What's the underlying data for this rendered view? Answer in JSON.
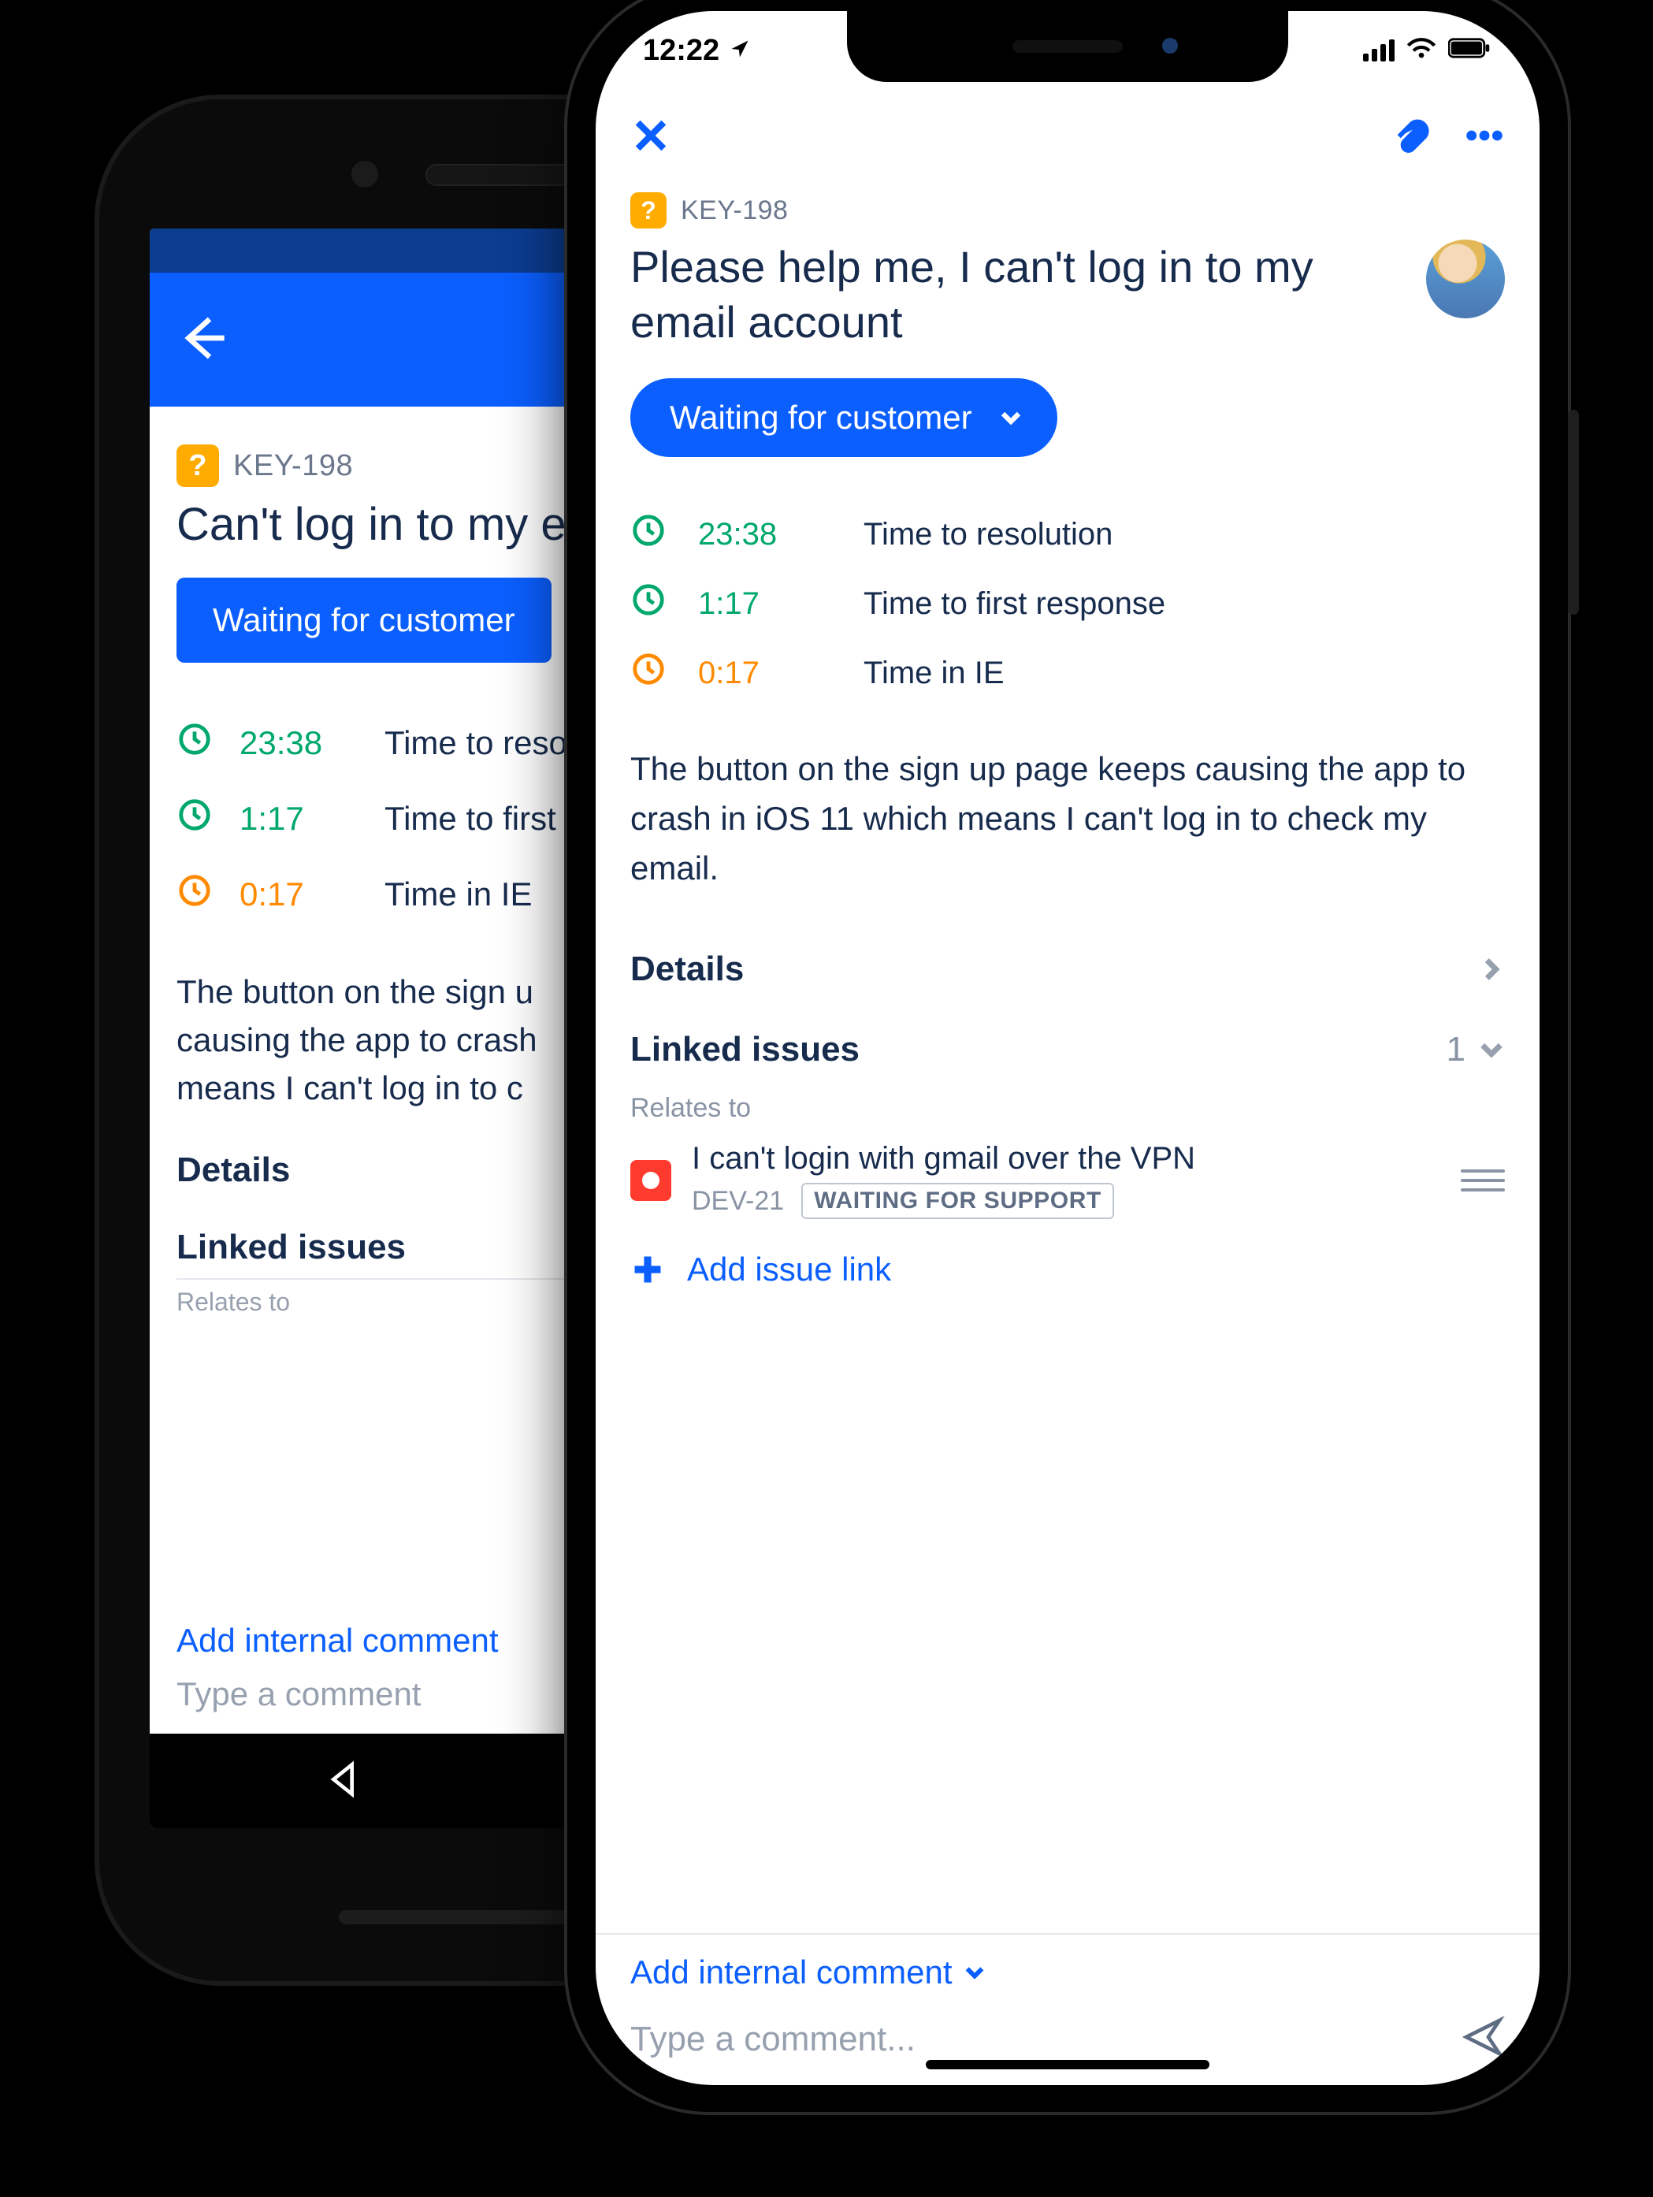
{
  "colors": {
    "accent": "#0b5fff",
    "green": "#00a86b",
    "orange": "#ff8a00",
    "text": "#172b4d",
    "muted": "#8993a4"
  },
  "android": {
    "issue_key": "KEY-198",
    "title": "Can't log in to my em",
    "status_label": "Waiting for customer",
    "sla": [
      {
        "time": "23:38",
        "label": "Time to resolu",
        "tone": "green"
      },
      {
        "time": "1:17",
        "label": "Time to first re",
        "tone": "green"
      },
      {
        "time": "0:17",
        "label": "Time in IE",
        "tone": "orange"
      }
    ],
    "description": "The button on the sign u\ncausing the app to crash\nmeans I can't log in to c",
    "section_details": "Details",
    "section_linked": "Linked issues",
    "relates_to_label": "Relates to",
    "add_internal_label": "Add internal comment",
    "type_placeholder": "Type a comment"
  },
  "ios": {
    "status_time": "12:22",
    "issue_key": "KEY-198",
    "title": "Please help me, I can't log in to my email account",
    "status_label": "Waiting for customer",
    "sla": [
      {
        "time": "23:38",
        "label": "Time to resolution",
        "tone": "green"
      },
      {
        "time": "1:17",
        "label": "Time to first response",
        "tone": "green"
      },
      {
        "time": "0:17",
        "label": "Time in IE",
        "tone": "orange"
      }
    ],
    "description": "The button on the sign up page keeps causing the app to crash in iOS 11 which means I can't log in to check my email.",
    "section_details": "Details",
    "section_linked": "Linked issues",
    "linked_count": "1",
    "relates_to_label": "Relates to",
    "linked_issue": {
      "title": "I can't login with gmail over the VPN",
      "key": "DEV-21",
      "status": "WAITING FOR SUPPORT"
    },
    "add_issue_link_label": "Add issue link",
    "add_internal_label": "Add internal comment",
    "type_placeholder": "Type a comment..."
  }
}
